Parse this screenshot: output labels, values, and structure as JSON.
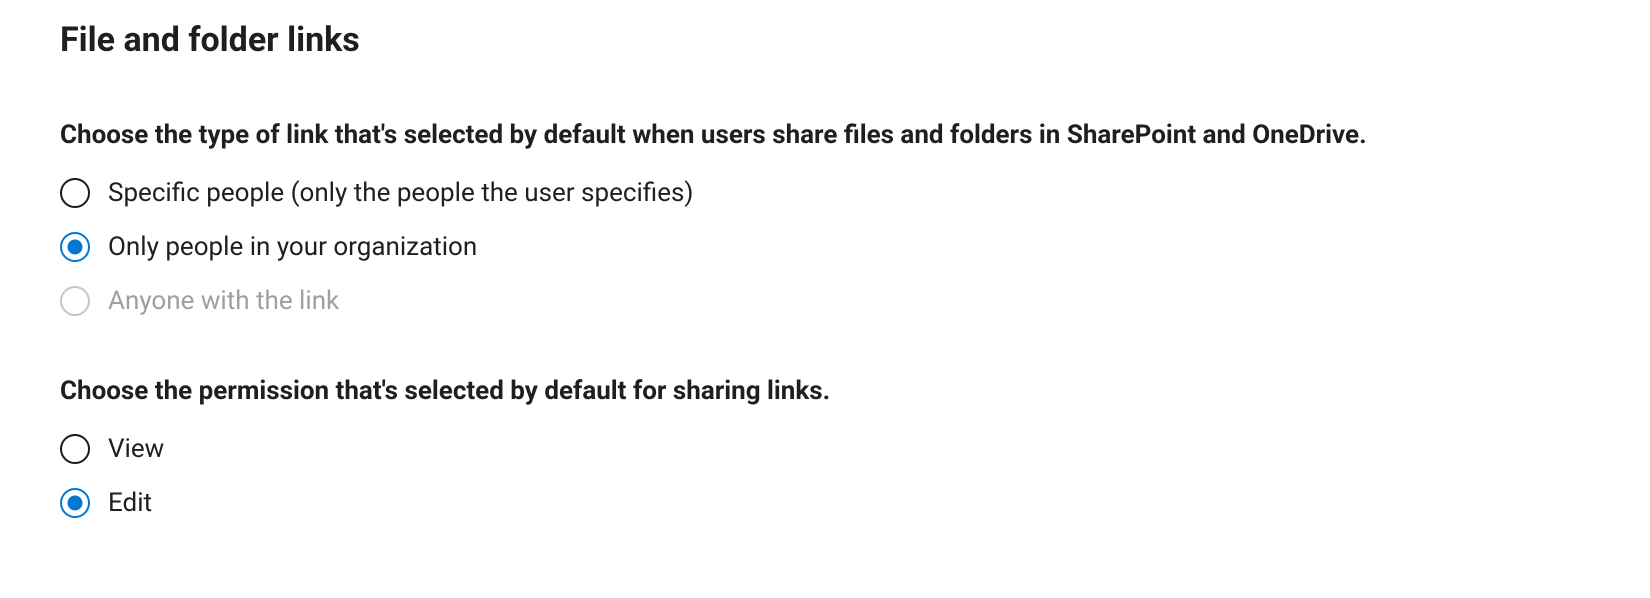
{
  "section": {
    "title": "File and folder links",
    "link_type": {
      "subtitle": "Choose the type of link that's selected by default when users share files and folders in SharePoint and OneDrive.",
      "options": [
        {
          "label": "Specific people (only the people the user specifies)",
          "selected": false,
          "disabled": false
        },
        {
          "label": "Only people in your organization",
          "selected": true,
          "disabled": false
        },
        {
          "label": "Anyone with the link",
          "selected": false,
          "disabled": true
        }
      ]
    },
    "permission": {
      "subtitle": "Choose the permission that's selected by default for sharing links.",
      "options": [
        {
          "label": "View",
          "selected": false,
          "disabled": false
        },
        {
          "label": "Edit",
          "selected": true,
          "disabled": false
        }
      ]
    }
  }
}
